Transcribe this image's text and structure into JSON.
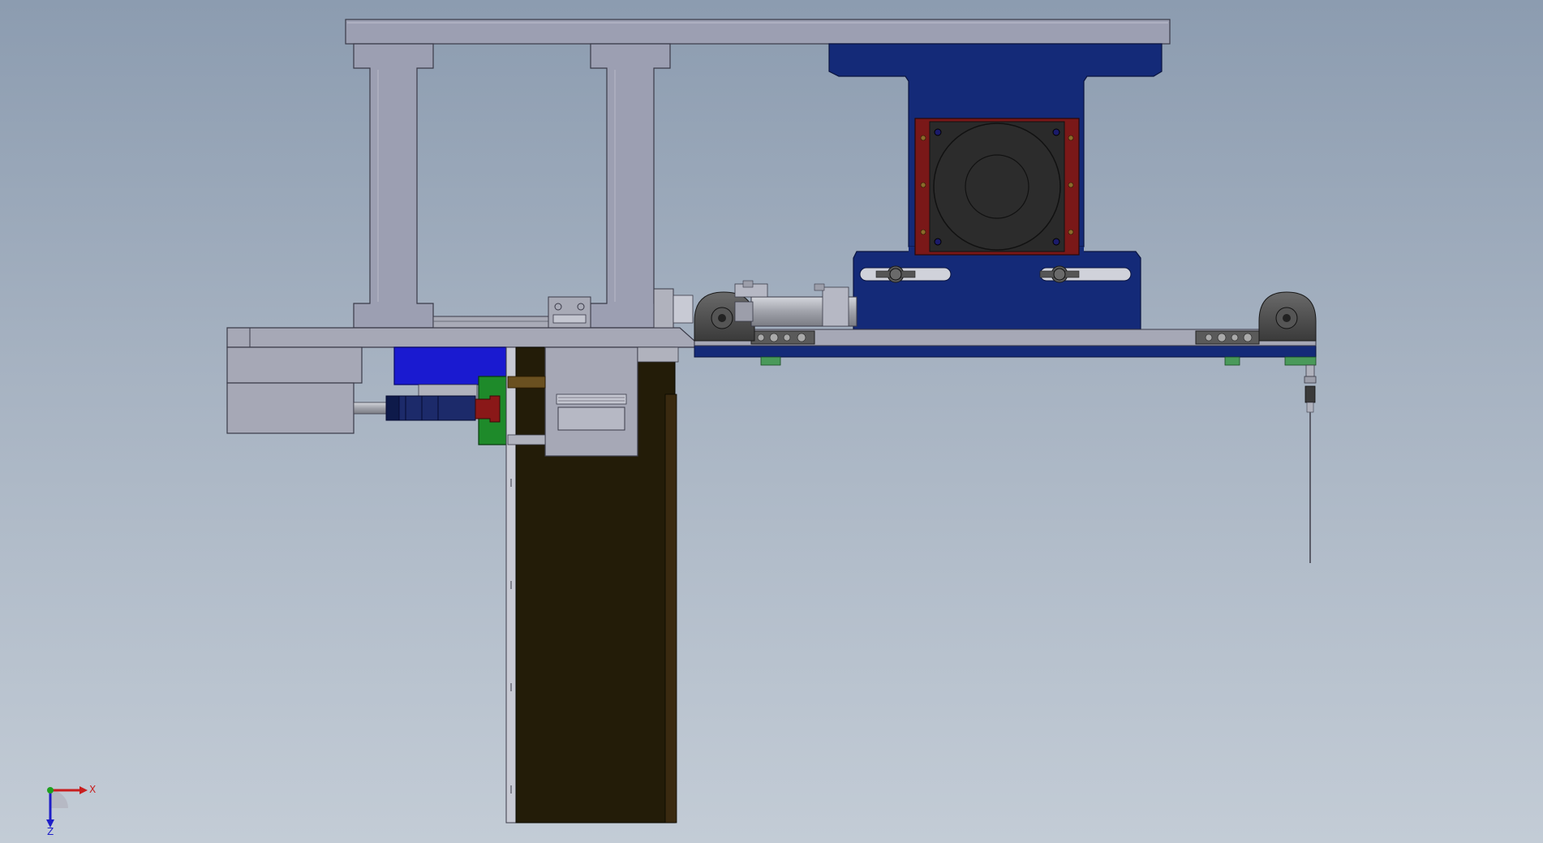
{
  "viewport": {
    "background_top": "#8c9cb0",
    "background_bottom": "#c3ccd6"
  },
  "colors": {
    "frame_gray": "#9c9fb2",
    "frame_edge": "#3a3a48",
    "navy": "#142a78",
    "motor_red": "#7a1818",
    "motor_dark": "#2a2a2a",
    "blue_block": "#1a1ad0",
    "green_block": "#1e8a2a",
    "brown_panel": "#231c08",
    "silver": "#b0b2bd",
    "needle_green": "#4a9a5a"
  },
  "triad": {
    "x_label": "X",
    "z_label": "Z",
    "x_color": "#c81e1e",
    "y_color": "#1ea01e",
    "z_color": "#1e1ec8"
  }
}
